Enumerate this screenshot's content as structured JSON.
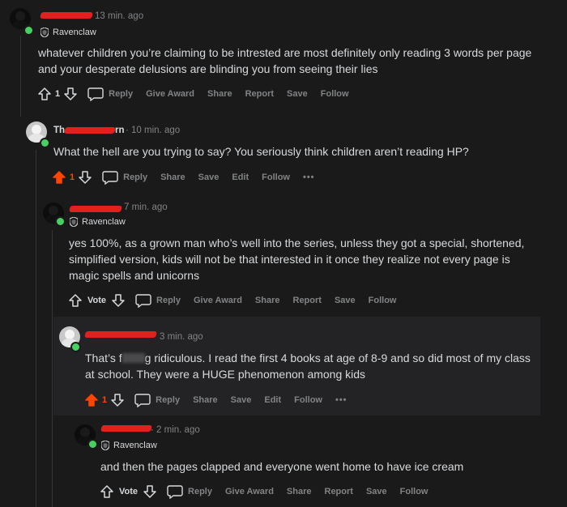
{
  "colors": {
    "background": "#1a1a1b",
    "text": "#d7dadc",
    "muted": "#818384",
    "upvote_active": "#ff4500",
    "online": "#46d160"
  },
  "comments": [
    {
      "time": "13 min. ago",
      "flair": "Ravenclaw",
      "text": "whatever children you’re claiming to be intrested are most definitely only reading 3 words per page and your desperate delusions are blinding you from seeing their lies",
      "score": "1",
      "upvoted": false,
      "actions": [
        "Reply",
        "Give Award",
        "Share",
        "Report",
        "Save",
        "Follow"
      ]
    },
    {
      "username_visible": "Th",
      "username_tail": "rn",
      "time": "10 min. ago",
      "text": "What the hell are you trying to say? You seriously think children aren’t reading HP?",
      "score": "1",
      "upvoted": true,
      "actions": [
        "Reply",
        "Share",
        "Save",
        "Edit",
        "Follow"
      ],
      "more": "•••"
    },
    {
      "time": "7 min. ago",
      "flair": "Ravenclaw",
      "text": "yes 100%, as a grown man who’s well into the series, unless they got a special, shortened, simplified version, kids will not be that interested in it once they realize not every page is magic spells and unicorns",
      "score": "Vote",
      "upvoted": false,
      "actions": [
        "Reply",
        "Give Award",
        "Share",
        "Report",
        "Save",
        "Follow"
      ]
    },
    {
      "time": "3 min. ago",
      "text": "That’s f████g ridiculous. I read the first 4 books at age of 8-9 and so did most of my class at school. They were a HUGE phenomenon among kids",
      "text_part1": "That’s f",
      "text_part2": "g ridiculous. I read the first 4 books at age of 8-9 and so did most of my class at school. They were a HUGE phenomenon among kids",
      "score": "1",
      "upvoted": true,
      "actions": [
        "Reply",
        "Share",
        "Save",
        "Edit",
        "Follow"
      ],
      "more": "•••"
    },
    {
      "time": "2 min. ago",
      "flair": "Ravenclaw",
      "text": "and then the pages clapped and everyone went home to have ice cream",
      "score": "Vote",
      "upvoted": false,
      "actions": [
        "Reply",
        "Give Award",
        "Share",
        "Report",
        "Save",
        "Follow"
      ]
    }
  ]
}
